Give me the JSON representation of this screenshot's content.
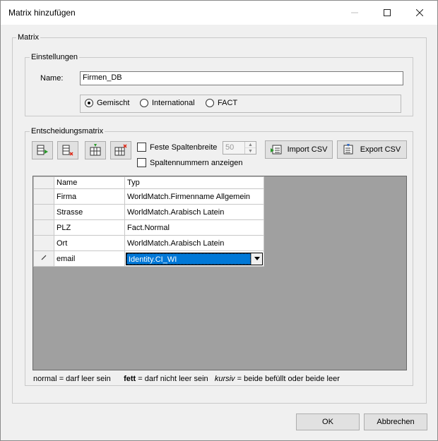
{
  "window": {
    "title": "Matrix hinzufügen"
  },
  "matrix_group": {
    "label": "Matrix"
  },
  "settings_group": {
    "label": "Einstellungen",
    "name_label": "Name:",
    "name_value": "Firmen_DB",
    "mode_options": [
      {
        "label": "Gemischt",
        "selected": true
      },
      {
        "label": "International",
        "selected": false
      },
      {
        "label": "FACT",
        "selected": false
      }
    ]
  },
  "decision_group": {
    "label": "Entscheidungsmatrix",
    "fixed_width_label": "Feste Spaltenbreite",
    "fixed_width_checked": false,
    "column_width_value": "50",
    "show_numbers_label": "Spaltennummern anzeigen",
    "show_numbers_checked": false,
    "import_label": "Import CSV",
    "export_label": "Export CSV"
  },
  "grid": {
    "columns": [
      "Name",
      "Typ"
    ],
    "rows": [
      {
        "name": "Firma",
        "typ": "WorldMatch.Firmenname Allgemein",
        "editing": false
      },
      {
        "name": "Strasse",
        "typ": "WorldMatch.Arabisch Latein",
        "editing": false
      },
      {
        "name": "PLZ",
        "typ": "Fact.Normal",
        "editing": false
      },
      {
        "name": "Ort",
        "typ": "WorldMatch.Arabisch Latein",
        "editing": false
      },
      {
        "name": "email",
        "typ": "Identity.CI_WI",
        "editing": true
      }
    ]
  },
  "legend": {
    "normal": "normal",
    "normal_text": "= darf leer sein",
    "bold": "fett",
    "bold_text": "= darf nicht leer sein",
    "italic": "kursiv",
    "italic_text": "= beide befüllt oder beide leer"
  },
  "buttons": {
    "ok": "OK",
    "cancel": "Abbrechen"
  },
  "colors": {
    "selection": "#0078d7",
    "grid_background": "#a0a0a0",
    "window_background": "#f0f0f0"
  },
  "icons": {
    "add_row": "add-row-icon",
    "delete_row": "delete-row-icon",
    "add_column": "add-column-icon",
    "delete_column": "delete-column-icon",
    "import": "import-csv-icon",
    "export": "export-csv-icon",
    "edit_pencil": "pencil-icon"
  }
}
